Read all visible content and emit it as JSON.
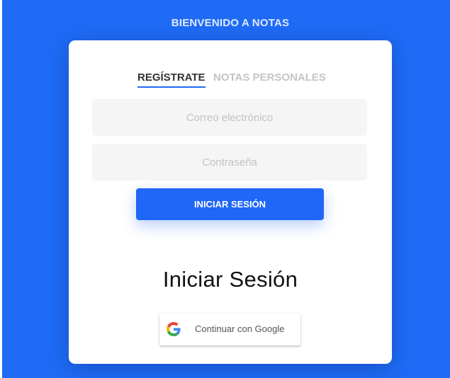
{
  "header": {
    "title": "BIENVENIDO A NOTAS"
  },
  "tabs": [
    {
      "label": "REGÍSTRATE",
      "active": true
    },
    {
      "label": "NOTAS PERSONALES",
      "active": false
    }
  ],
  "form": {
    "email_placeholder": "Correo electrónico",
    "email_value": "",
    "password_placeholder": "Contraseña",
    "password_value": "",
    "submit_label": "INICIAR SESIÓN"
  },
  "social": {
    "heading": "Iniciar Sesión",
    "google_label": "Continuar con Google",
    "google_icon": "google-g-icon"
  },
  "colors": {
    "background": "#1f6bf5",
    "accent": "#2066f7",
    "card": "#ffffff",
    "field": "#f5f5f5"
  }
}
